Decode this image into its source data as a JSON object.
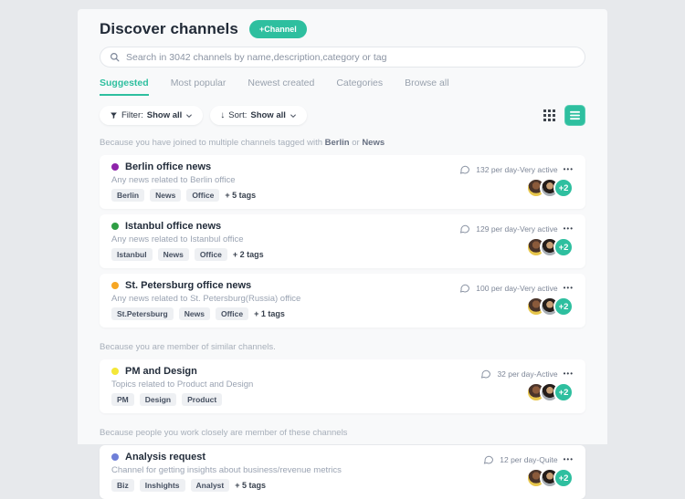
{
  "header": {
    "title": "Discover channels",
    "add_channel": "+Channel"
  },
  "search": {
    "placeholder": "Search in 3042 channels by name,description,category or tag"
  },
  "tabs": [
    {
      "label": "Suggested",
      "active": true
    },
    {
      "label": "Most popular",
      "active": false
    },
    {
      "label": "Newest created",
      "active": false
    },
    {
      "label": "Categories",
      "active": false
    },
    {
      "label": "Browse all",
      "active": false
    }
  ],
  "toolbar": {
    "filter_label": "Filter:",
    "filter_value": "Show all",
    "sort_label": "Sort:",
    "sort_value": "Show all",
    "sort_arrow": "↓"
  },
  "ui": {
    "more_options": "•••",
    "accent_color": "#2ebf9f"
  },
  "sections": [
    {
      "reason": {
        "pre": "Because you have joined to multiple channels tagged with ",
        "b1": "Berlin",
        "mid": " or ",
        "b2": "News",
        "post": ""
      },
      "channels": [
        {
          "name": "Berlin office news",
          "dot_color": "#8e24aa",
          "description": "Any news related to Berlin office",
          "tags": [
            "Berlin",
            "News",
            "Office"
          ],
          "more_tags": "+ 5 tags",
          "activity": "132 per day-Very active",
          "overflow": "+2"
        },
        {
          "name": "Istanbul office news",
          "dot_color": "#2e9e44",
          "description": "Any news related to Istanbul office",
          "tags": [
            "Istanbul",
            "News",
            "Office"
          ],
          "more_tags": "+ 2 tags",
          "activity": "129 per day-Very active",
          "overflow": "+2"
        },
        {
          "name": "St. Petersburg office news",
          "dot_color": "#f6a623",
          "description": "Any news related to St. Petersburg(Russia) office",
          "tags": [
            "St.Petersburg",
            "News",
            "Office"
          ],
          "more_tags": "+ 1 tags",
          "activity": "100 per day-Very active",
          "overflow": "+2"
        }
      ]
    },
    {
      "reason": {
        "pre": "Because you are member of similar channels.",
        "b1": "",
        "mid": "",
        "b2": "",
        "post": ""
      },
      "channels": [
        {
          "name": "PM and Design",
          "dot_color": "#f4e738",
          "description": "Topics related to Product and Design",
          "tags": [
            "PM",
            "Design",
            "Product"
          ],
          "more_tags": "",
          "activity": "32 per day-Active",
          "overflow": "+2"
        }
      ]
    },
    {
      "reason": {
        "pre": "Because people you work closely are member of these channels",
        "b1": "",
        "mid": "",
        "b2": "",
        "post": ""
      },
      "channels": [
        {
          "name": "Analysis request",
          "dot_color": "#6f7fd8",
          "description": "Channel for getting insights about business/revenue metrics",
          "tags": [
            "Biz",
            "Inshights",
            "Analyst"
          ],
          "more_tags": "+ 5 tags",
          "activity": "12 per day-Quite",
          "overflow": "+2"
        }
      ]
    }
  ]
}
